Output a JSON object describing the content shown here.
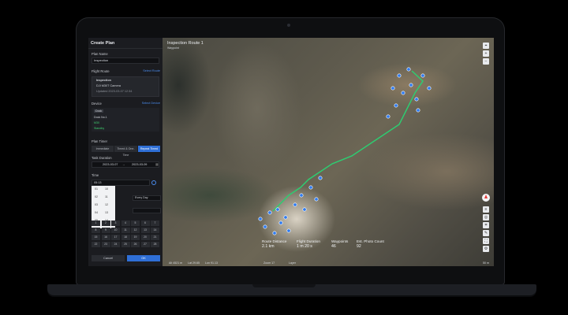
{
  "panel": {
    "title": "Create Plan",
    "plan_name_label": "Plan Name",
    "plan_name_value": "Inspection",
    "flight_route_label": "Flight Route",
    "select_route_link": "Select Route",
    "route": {
      "name": "Inspection",
      "camera": "DJI M30T Camera",
      "updated": "Updated 2023-03-07 12:34"
    },
    "device_label": "Device",
    "select_device_link": "Select Device",
    "device": {
      "tag": "Dock",
      "dock_name": "Dock No.1",
      "status_1": "M30",
      "status_2": "Standby"
    },
    "plan_timer_label": "Plan Timer",
    "plan_timer_options": [
      "Immediate",
      "Timed & One-Time",
      "Repeat Timed"
    ],
    "task_duration_label": "Task Duration",
    "date_start": "2023-03-07",
    "date_end": "2023-03-09",
    "time_label": "Time",
    "time_value": "05:13",
    "clock_hours": [
      "01",
      "02",
      "03",
      "04",
      "05"
    ],
    "clock_minutes": [
      "10",
      "11",
      "12",
      "13",
      "14"
    ],
    "select_value": "Every Day",
    "grid_numbers": [
      "1",
      "2",
      "3",
      "4",
      "5",
      "6",
      "7",
      "8",
      "9",
      "10",
      "11",
      "12",
      "13",
      "14",
      "15",
      "16",
      "17",
      "18",
      "19",
      "20",
      "21",
      "22",
      "23",
      "24",
      "25",
      "26",
      "27",
      "28"
    ],
    "cancel_label": "Cancel",
    "ok_label": "OK"
  },
  "map": {
    "title": "Inspection Route 1",
    "subtitle": "Waypoint",
    "stats": [
      {
        "label": "Route Distance",
        "value": "2.1 km"
      },
      {
        "label": "Flight Duration",
        "value": "1 m 20 s"
      },
      {
        "label": "Waypoints",
        "value": "46"
      },
      {
        "label": "Est. Photo Count",
        "value": "92"
      }
    ],
    "bottom_items": [
      "Alt 4521 m",
      "Lat 29.65",
      "Lon 91.13",
      "Zoom 17",
      "Layer"
    ],
    "scale": "50 m",
    "route_color": "#2ecc71",
    "waypoint_color": "#2f7bf0"
  }
}
